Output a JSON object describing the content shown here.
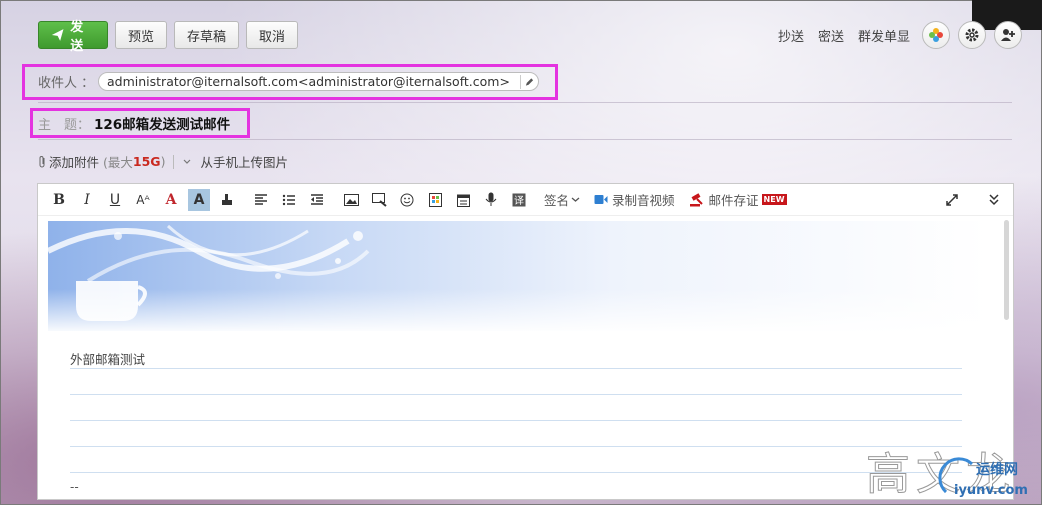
{
  "toolbar": {
    "send_label": "发送",
    "preview_label": "预览",
    "draft_label": "存草稿",
    "cancel_label": "取消"
  },
  "top_links": {
    "cc": "抄送",
    "bcc": "密送",
    "separate": "群发单显"
  },
  "recipient": {
    "label": "收件人",
    "colon": "：",
    "value": "administrator@iternalsoft.com<administrator@iternalsoft.com>"
  },
  "subject": {
    "label": "主　题",
    "colon": "：",
    "value": "126邮箱发送测试邮件"
  },
  "attachment": {
    "add_label": "添加附件",
    "limit_prefix": "(最大",
    "limit_value": "15G",
    "limit_suffix": ")",
    "upload_phone": "从手机上传图片"
  },
  "editor_toolbar": {
    "bold": "B",
    "italic": "I",
    "underline": "U",
    "font_size": "Aᴬ",
    "font_color": "A",
    "bg_color": "A",
    "signature_label": "签名",
    "record_video": "录制音视频",
    "mail_evidence": "邮件存证",
    "new_badge": "NEW"
  },
  "body": {
    "text": "外部邮箱测试",
    "signature_separator": "--"
  },
  "watermark": {
    "chars": "高文龙",
    "site_name": "运维网",
    "site_url": "iyunv.com"
  },
  "colors": {
    "send_green": "#4aaa36",
    "highlight_magenta": "#e433e0",
    "limit_red": "#c9291f"
  }
}
